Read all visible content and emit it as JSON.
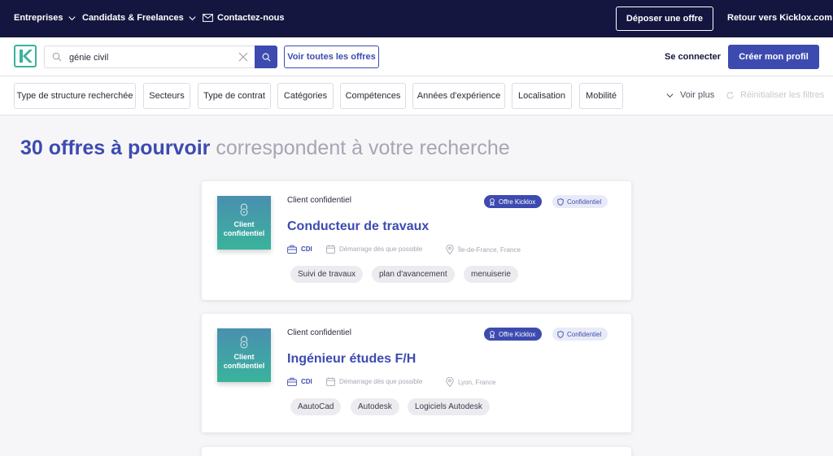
{
  "topnav": {
    "enterprises": "Entreprises",
    "candidates": "Candidats & Freelances",
    "contact": "Contactez-nous",
    "deposit": "Déposer une offre",
    "back": "Retour vers Kicklox.com"
  },
  "search": {
    "value": "génie civil",
    "see_all": "Voir toutes les offres",
    "login": "Se connecter",
    "create_profile": "Créer mon profil"
  },
  "filters": {
    "items": [
      "Type de structure recherchée",
      "Secteurs",
      "Type de contrat",
      "Catégories",
      "Compétences",
      "Années d'expérience",
      "Localisation",
      "Mobilité"
    ],
    "see_more": "Voir plus",
    "reset": "Réinitialiser les filtres"
  },
  "heading": {
    "count": "30 offres à pourvoir",
    "rest": "correspondent à votre recherche"
  },
  "colors": {
    "navy": "#14163f",
    "accent": "#3d4bb0"
  },
  "offers": [
    {
      "thumb_text": "Client confidentiel",
      "client": "Client confidentiel",
      "badge_kicklox": "Offre Kicklox",
      "badge_conf": "Confidentiel",
      "title": "Conducteur de travaux",
      "contract": "CDI",
      "start": "Démarrage dès que possible",
      "location": "Île-de-France, France",
      "tags": [
        "Suivi de travaux",
        "plan d'avancement",
        "menuiserie"
      ]
    },
    {
      "thumb_text": "Client confidentiel",
      "client": "Client confidentiel",
      "badge_kicklox": "Offre Kicklox",
      "badge_conf": "Confidentiel",
      "title": "Ingénieur études F/H",
      "contract": "CDI",
      "start": "Démarrage dès que possible",
      "location": "Lyon, France",
      "tags": [
        "AautoCad",
        "Autodesk",
        "Logiciels Autodesk"
      ]
    }
  ]
}
